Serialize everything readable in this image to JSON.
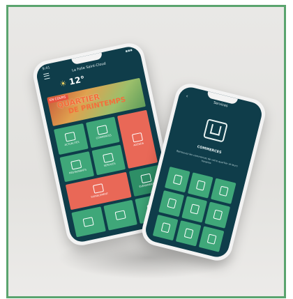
{
  "phone1": {
    "title": "La Folie Saint-Cloud",
    "temperature": "12°",
    "banner_tag": "EN COURS",
    "banner_line1": "QUARTIER",
    "banner_line2": "DE PRINTEMPS",
    "tiles": [
      {
        "label": "ACTUALITÉS",
        "color": "green"
      },
      {
        "label": "COMMERCES",
        "color": "green"
      },
      {
        "label": "AGENDA",
        "color": "red"
      },
      {
        "label": "RESTAURANTS",
        "color": "green"
      },
      {
        "label": "SERVICES",
        "color": "green"
      },
      {
        "label": "SIGNALEMENT",
        "color": "red"
      },
      {
        "label": "ÉVÉNEMENTS",
        "color": "green"
      },
      {
        "label": "",
        "color": "green"
      },
      {
        "label": "",
        "color": "green"
      },
      {
        "label": "",
        "color": "green"
      }
    ]
  },
  "phone2": {
    "title": "Services",
    "name": "COMMERCES",
    "description": "Retrouvez les commerces de votre quartier et leurs horaires"
  },
  "colors": {
    "frame_border": "#5aa46e",
    "screen_bg": "#0f3d4a",
    "tile_green": "#3fa779",
    "tile_red": "#e96857"
  }
}
